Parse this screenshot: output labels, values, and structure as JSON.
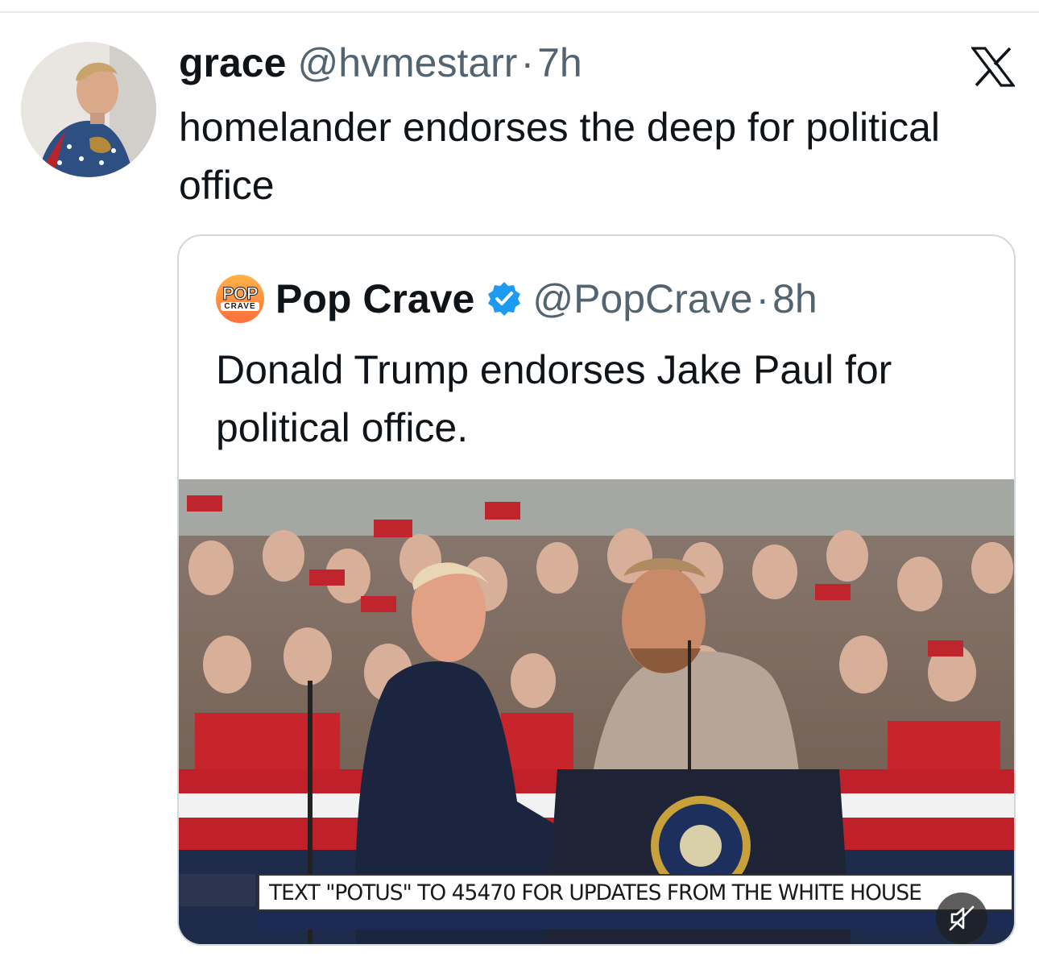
{
  "tweet": {
    "author_name": "grace",
    "author_handle": "@hvmestarr",
    "separator": "·",
    "time": "7h",
    "text": "homelander endorses the deep for political office"
  },
  "quote": {
    "logo_text_top": "POP",
    "logo_text_bottom": "CRAVE",
    "author_name": "Pop Crave",
    "verified": true,
    "author_handle": "@PopCrave",
    "separator": "·",
    "time": "8h",
    "text": "Donald Trump endorses Jake Paul for political office.",
    "media": {
      "type": "video",
      "chyron": "TEXT \"POTUS\" TO 45470 FOR UPDATES FROM THE WHITE HOUSE",
      "muted": true
    }
  },
  "icons": {
    "platform": "x-logo-icon",
    "verified": "verified-badge-icon",
    "mute": "muted-speaker-icon"
  },
  "colors": {
    "text": "#0f1419",
    "secondary": "#536471",
    "verified": "#1d9bf0",
    "border": "#cfd9de"
  }
}
